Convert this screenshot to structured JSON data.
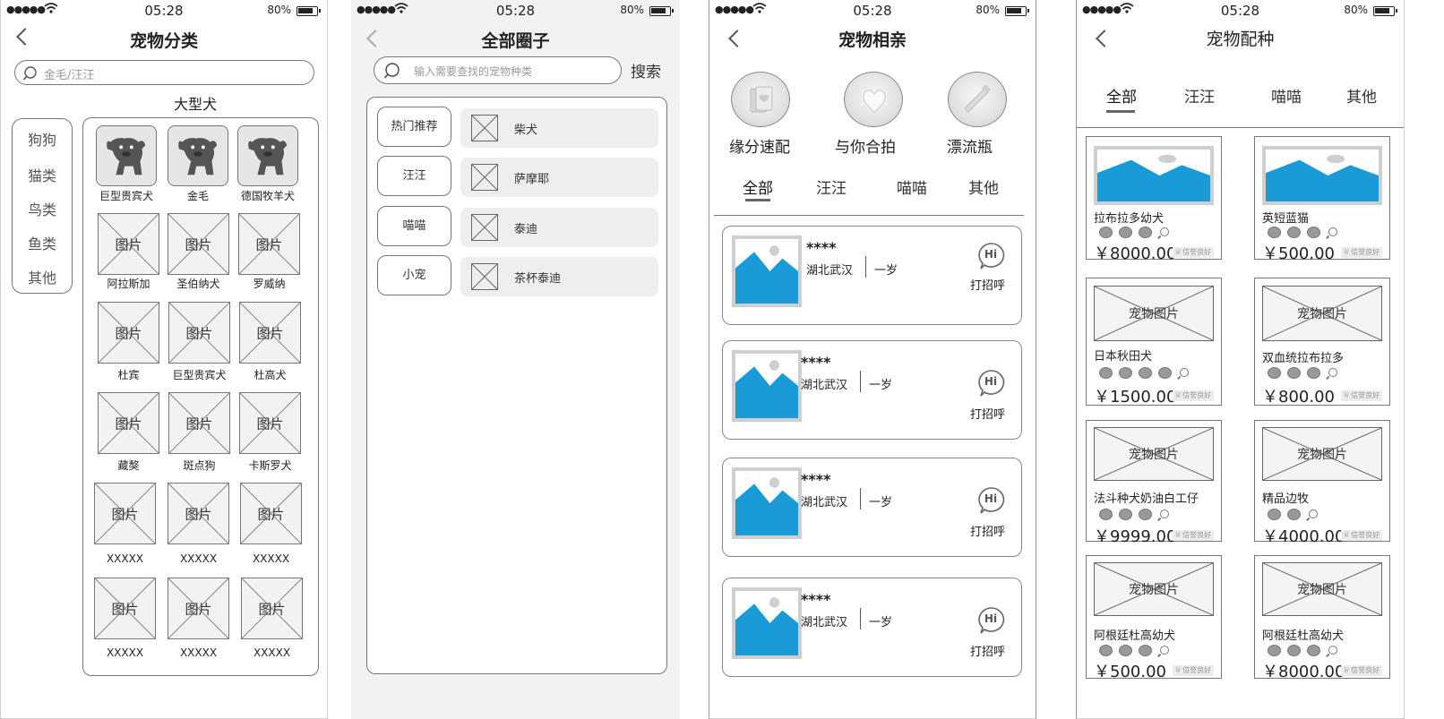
{
  "status": {
    "time": "05:28",
    "battery": "80%"
  },
  "screen1": {
    "title": "宠物分类",
    "search_placeholder": "金毛/汪汪",
    "section_title": "大型犬",
    "categories": [
      "狗狗",
      "猫类",
      "鸟类",
      "鱼类",
      "其他"
    ],
    "featured": [
      "巨型贵宾犬",
      "金毛",
      "德国牧羊犬"
    ],
    "grid_rows": [
      [
        "阿拉斯加",
        "圣伯纳犬",
        "罗威纳"
      ],
      [
        "杜宾",
        "巨型贵宾犬",
        "杜高犬"
      ],
      [
        "藏獒",
        "斑点狗",
        "卡斯罗犬"
      ],
      [
        "XXXXX",
        "XXXXX",
        "XXXXX"
      ],
      [
        "XXXXX",
        "XXXXX",
        "XXXXX"
      ]
    ],
    "placeholder_label": "图片"
  },
  "screen2": {
    "title": "全部圈子",
    "search_placeholder": "输入需要查找的宠物种类",
    "search_button": "搜索",
    "categories": [
      "热门推荐",
      "汪汪",
      "喵喵",
      "小宠"
    ],
    "items": [
      "柴犬",
      "萨摩耶",
      "泰迪",
      "茶杯泰迪"
    ]
  },
  "screen3": {
    "title": "宠物相亲",
    "features": [
      "缘分速配",
      "与你合拍",
      "漂流瓶"
    ],
    "tabs": [
      "全部",
      "汪汪",
      "喵喵",
      "其他"
    ],
    "cards": [
      {
        "name": "****",
        "location": "湖北武汉",
        "age": "一岁",
        "hi": "Hi",
        "action": "打招呼"
      },
      {
        "name": "****",
        "location": "湖北武汉",
        "age": "一岁",
        "hi": "Hi",
        "action": "打招呼"
      },
      {
        "name": "****",
        "location": "湖北武汉",
        "age": "一岁",
        "hi": "Hi",
        "action": "打招呼"
      },
      {
        "name": "****",
        "location": "湖北武汉",
        "age": "一岁",
        "hi": "Hi",
        "action": "打招呼"
      }
    ]
  },
  "screen4": {
    "title": "宠物配种",
    "tabs": [
      "全部",
      "汪汪",
      "喵喵",
      "其他"
    ],
    "placeholder_label": "宠物图片",
    "credit_label": "信誉良好",
    "products": [
      {
        "name": "拉布拉多幼犬",
        "price": "￥8000.00"
      },
      {
        "name": "英短蓝猫",
        "price": "￥500.00"
      },
      {
        "name": "日本秋田犬",
        "price": "￥1500.00"
      },
      {
        "name": "双血统拉布拉多",
        "price": "￥800.00"
      },
      {
        "name": "法斗种犬奶油白工仔",
        "price": "￥9999.00"
      },
      {
        "name": "精品边牧",
        "price": "￥4000.00"
      },
      {
        "name": "阿根廷杜高幼犬",
        "price": "￥500.00"
      },
      {
        "name": "阿根廷杜高幼犬",
        "price": "￥8000.00"
      }
    ]
  },
  "colors": {
    "accent_blue": "#1a9ad6",
    "line_gray": "#888888",
    "panel_gray": "#f2f2f2"
  }
}
